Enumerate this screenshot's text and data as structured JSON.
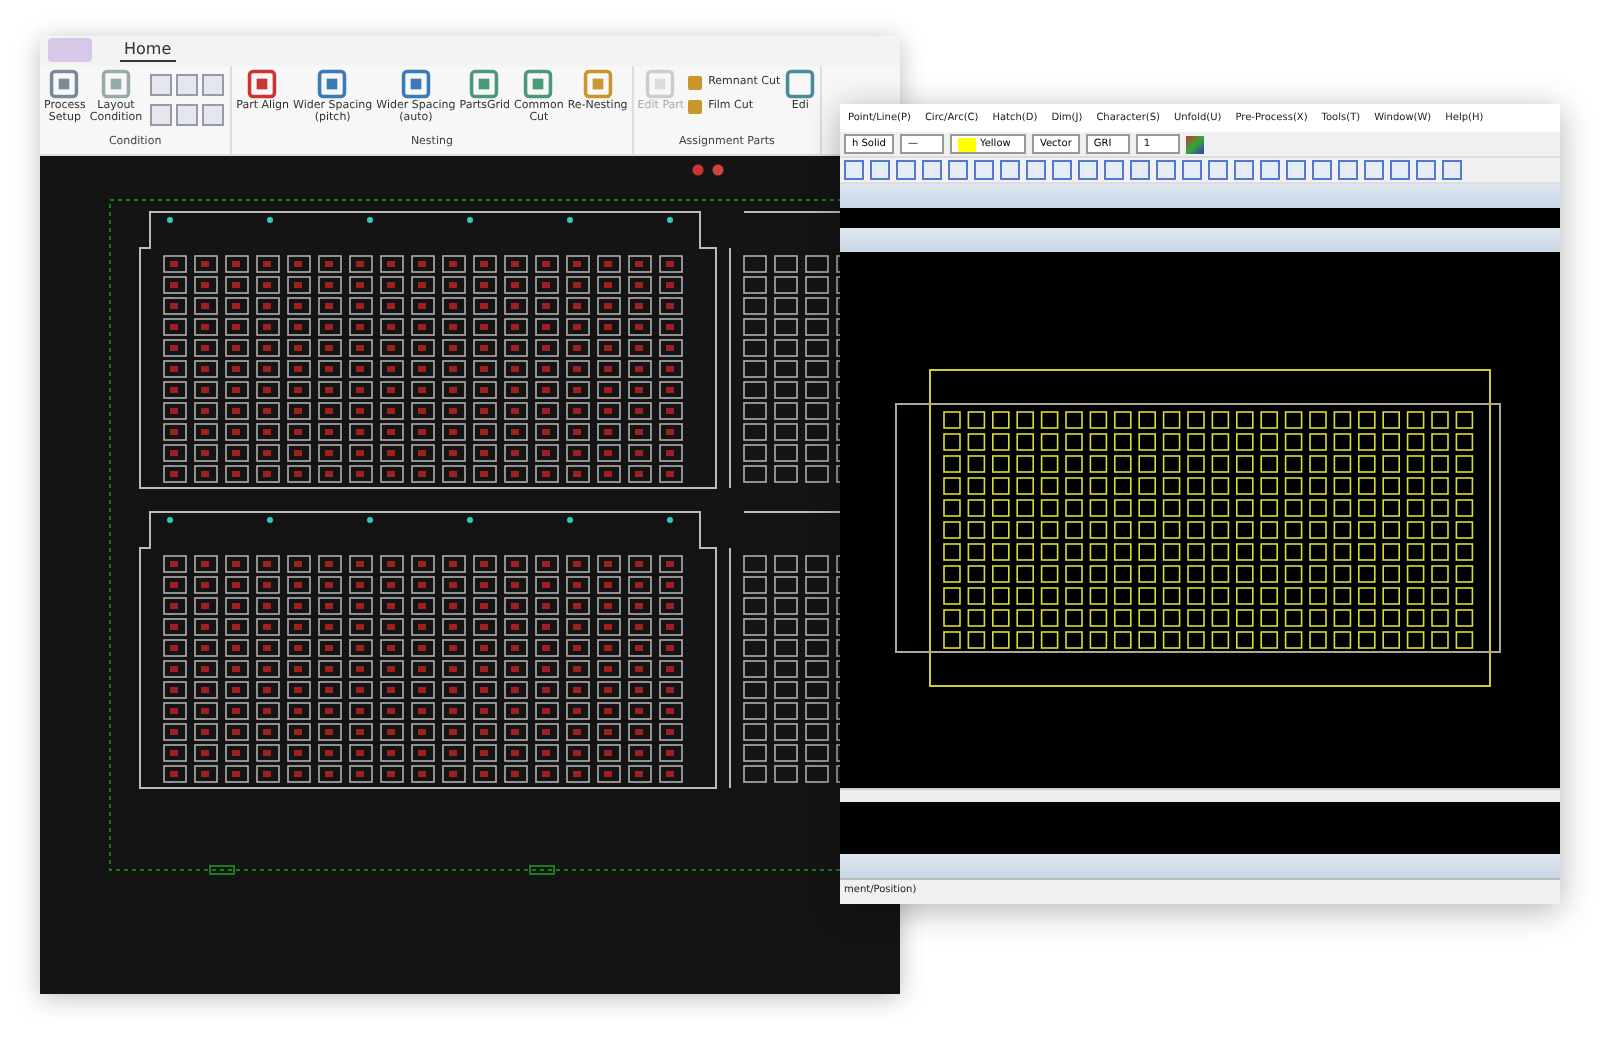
{
  "nesting_window": {
    "app_button": {
      "kind": "app"
    },
    "tabs": [
      {
        "label": "Home",
        "selected": true
      }
    ],
    "ribbon_groups": [
      {
        "label": "Condition",
        "buttons": [
          {
            "label": "Process\nSetup",
            "disabled": false
          },
          {
            "label": "Layout\nCondition",
            "disabled": false
          }
        ]
      },
      {
        "label": "Nesting",
        "buttons": [
          {
            "label": "Part Align",
            "disabled": false
          },
          {
            "label": "Wider Spacing\n(pitch)",
            "disabled": false
          },
          {
            "label": "Wider Spacing\n(auto)",
            "disabled": false
          },
          {
            "label": "PartsGrid",
            "disabled": false
          },
          {
            "label": "Common\nCut",
            "disabled": false
          },
          {
            "label": "Re-Nesting",
            "disabled": false
          }
        ]
      },
      {
        "label": "Assignment Parts",
        "buttons": [
          {
            "label": "Edit Part",
            "disabled": true
          }
        ],
        "small_buttons": [
          {
            "label": "Remnant Cut"
          },
          {
            "label": "Film Cut"
          }
        ],
        "trailing": {
          "label": "Edi"
        }
      }
    ]
  },
  "cad_window": {
    "menu": [
      "Point/Line(P)",
      "Circ/Arc(C)",
      "Hatch(D)",
      "Dim(J)",
      "Character(S)",
      "Unfold(U)",
      "Pre-Process(X)",
      "Tools(T)",
      "Window(W)",
      "Help(H)"
    ],
    "selectors": [
      {
        "value": "h Solid",
        "kind": "combo"
      },
      {
        "value": "—",
        "kind": "combo"
      },
      {
        "value": "Yellow",
        "kind": "color",
        "color": "#ffff00"
      },
      {
        "value": "Vector",
        "kind": "combo"
      },
      {
        "value": "GRI",
        "kind": "combo"
      },
      {
        "value": "1",
        "kind": "combo"
      }
    ],
    "status_text": "ment/Position)"
  }
}
